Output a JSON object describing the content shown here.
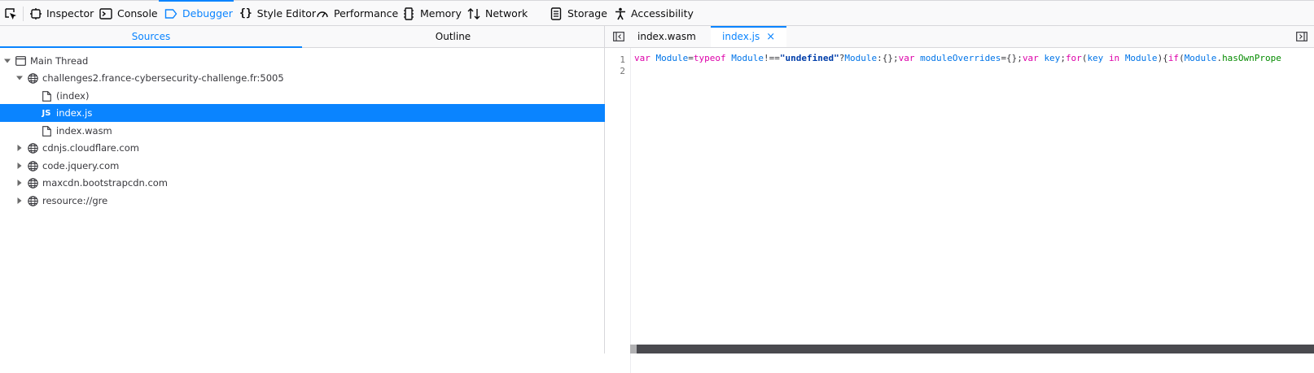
{
  "toolbar": {
    "tabs": [
      {
        "label": "Inspector",
        "icon": "inspector-icon"
      },
      {
        "label": "Console",
        "icon": "console-icon"
      },
      {
        "label": "Debugger",
        "icon": "debugger-icon",
        "selected": true
      },
      {
        "label": "Style Editor",
        "icon": "style-editor-icon"
      },
      {
        "label": "Performance",
        "icon": "performance-icon"
      },
      {
        "label": "Memory",
        "icon": "memory-icon"
      },
      {
        "label": "Network",
        "icon": "network-icon"
      },
      {
        "label": "Storage",
        "icon": "storage-icon"
      },
      {
        "label": "Accessibility",
        "icon": "accessibility-icon"
      }
    ],
    "accent_color": "#0a84ff"
  },
  "sources_panel": {
    "tabs": [
      {
        "label": "Sources",
        "active": true
      },
      {
        "label": "Outline",
        "active": false
      }
    ],
    "tree": [
      {
        "label": "Main Thread",
        "icon": "window-icon",
        "expanded": true,
        "depth": 0
      },
      {
        "label": "challenges2.france-cybersecurity-challenge.fr:5005",
        "icon": "globe-icon",
        "expanded": true,
        "depth": 1
      },
      {
        "label": "(index)",
        "icon": "file-icon",
        "depth": 2
      },
      {
        "label": "index.js",
        "icon": "js-icon",
        "icon_text": "JS",
        "depth": 2,
        "selected": true
      },
      {
        "label": "index.wasm",
        "icon": "file-icon",
        "depth": 2
      },
      {
        "label": "cdnjs.cloudflare.com",
        "icon": "globe-icon",
        "expanded": false,
        "depth": 1
      },
      {
        "label": "code.jquery.com",
        "icon": "globe-icon",
        "expanded": false,
        "depth": 1
      },
      {
        "label": "maxcdn.bootstrapcdn.com",
        "icon": "globe-icon",
        "expanded": false,
        "depth": 1
      },
      {
        "label": "resource://gre",
        "icon": "globe-icon",
        "expanded": false,
        "depth": 1
      }
    ]
  },
  "editor": {
    "tabs": [
      {
        "label": "index.wasm",
        "active": false
      },
      {
        "label": "index.js",
        "active": true,
        "close": "×"
      }
    ],
    "line_numbers": [
      "1",
      "2"
    ],
    "code_tokens": [
      {
        "t": "var ",
        "c": "kw"
      },
      {
        "t": "Module",
        "c": "id"
      },
      {
        "t": "=",
        "c": "pc"
      },
      {
        "t": "typeof ",
        "c": "kw"
      },
      {
        "t": "Module",
        "c": "id"
      },
      {
        "t": "!==",
        "c": "pc"
      },
      {
        "t": "\"undefined\"",
        "c": "str"
      },
      {
        "t": "?",
        "c": "pc"
      },
      {
        "t": "Module",
        "c": "id"
      },
      {
        "t": ":{};",
        "c": "pc"
      },
      {
        "t": "var ",
        "c": "kw"
      },
      {
        "t": "moduleOverrides",
        "c": "id"
      },
      {
        "t": "={};",
        "c": "pc"
      },
      {
        "t": "var ",
        "c": "kw"
      },
      {
        "t": "key",
        "c": "id"
      },
      {
        "t": ";",
        "c": "pc"
      },
      {
        "t": "for",
        "c": "kw"
      },
      {
        "t": "(",
        "c": "pc"
      },
      {
        "t": "key ",
        "c": "id"
      },
      {
        "t": "in ",
        "c": "kw"
      },
      {
        "t": "Module",
        "c": "id"
      },
      {
        "t": "){",
        "c": "pc"
      },
      {
        "t": "if",
        "c": "kw"
      },
      {
        "t": "(",
        "c": "pc"
      },
      {
        "t": "Module",
        "c": "id"
      },
      {
        "t": ".",
        "c": "pc"
      },
      {
        "t": "hasOwnPrope",
        "c": "fn"
      }
    ]
  }
}
